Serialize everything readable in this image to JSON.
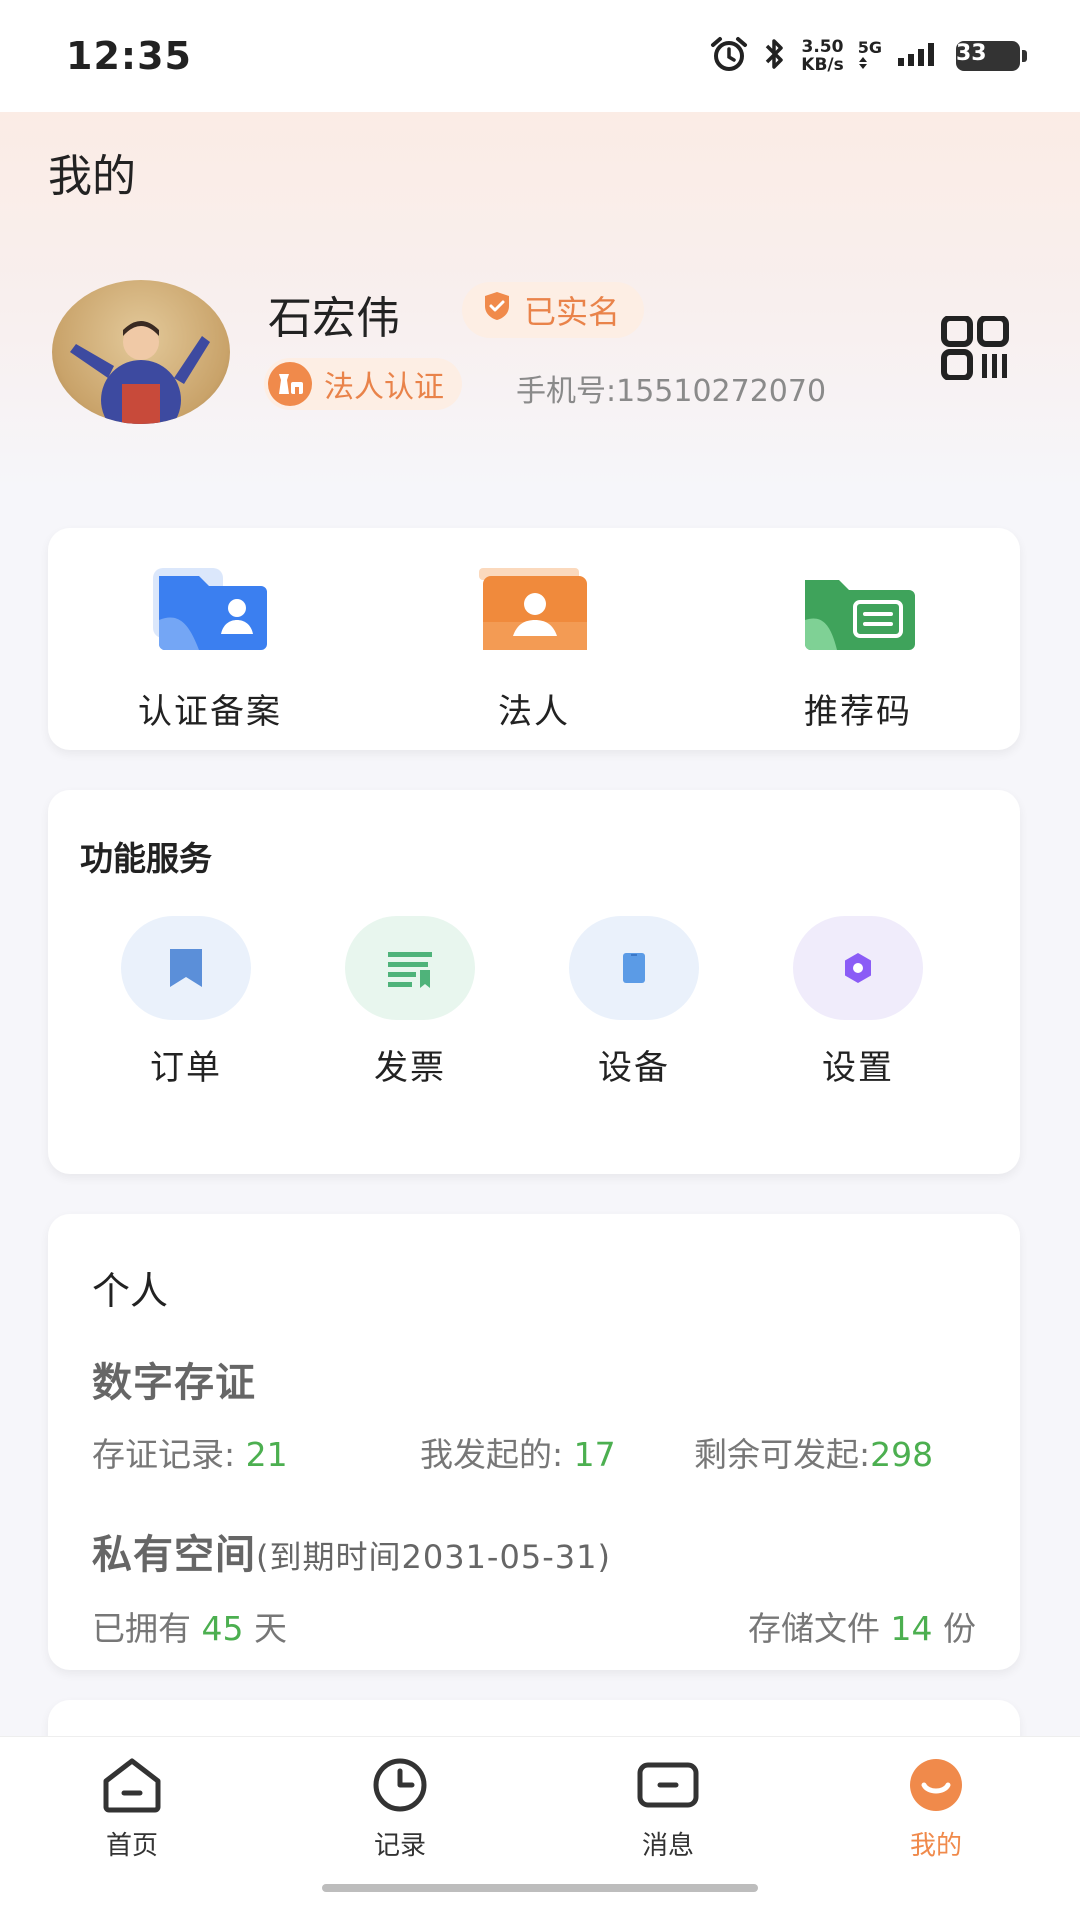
{
  "status_bar": {
    "time": "12:35",
    "net_speed_value": "3.50",
    "net_speed_unit": "KB/s",
    "network": "5G",
    "battery": "33"
  },
  "page": {
    "title": "我的"
  },
  "profile": {
    "name": "石宏伟",
    "verified_label": "已实名",
    "legal_cert_label": "法人认证",
    "phone": "手机号:15510272070"
  },
  "quick_actions": [
    {
      "label": "认证备案",
      "icon": "folder-person-icon",
      "color": "#3b82f6"
    },
    {
      "label": "法人",
      "icon": "id-card-icon",
      "color": "#f08a3c"
    },
    {
      "label": "推荐码",
      "icon": "ticket-folder-icon",
      "color": "#3fa35b"
    }
  ],
  "services": {
    "title": "功能服务",
    "items": [
      {
        "label": "订单",
        "icon": "bookmark-icon",
        "color": "#5b8fd9",
        "bg": "#eaf1fb"
      },
      {
        "label": "发票",
        "icon": "invoice-icon",
        "color": "#4fb37a",
        "bg": "#e8f6ee"
      },
      {
        "label": "设备",
        "icon": "phone-device-icon",
        "color": "#5b9be6",
        "bg": "#eaf1fb"
      },
      {
        "label": "设置",
        "icon": "hexagon-settings-icon",
        "color": "#8b5cf6",
        "bg": "#f0ecfb"
      }
    ]
  },
  "personal": {
    "title": "个人",
    "digital_cert": {
      "title": "数字存证",
      "records_label": "存证记录:",
      "records_value": "21",
      "initiated_label": "我发起的:",
      "initiated_value": "17",
      "remaining_label": "剩余可发起:",
      "remaining_value": "298"
    },
    "private_space": {
      "title": "私有空间",
      "expiry_note": "(到期时间2031-05-31)",
      "owned_prefix": "已拥有",
      "owned_value": "45",
      "owned_suffix": "天",
      "files_prefix": "存储文件",
      "files_value": "14",
      "files_suffix": "份"
    }
  },
  "tabbar": {
    "items": [
      {
        "label": "首页",
        "icon": "home-icon"
      },
      {
        "label": "记录",
        "icon": "clock-icon"
      },
      {
        "label": "消息",
        "icon": "message-icon"
      },
      {
        "label": "我的",
        "icon": "smile-profile-icon"
      }
    ],
    "active": "我的",
    "accent_color": "#f08a4b"
  }
}
